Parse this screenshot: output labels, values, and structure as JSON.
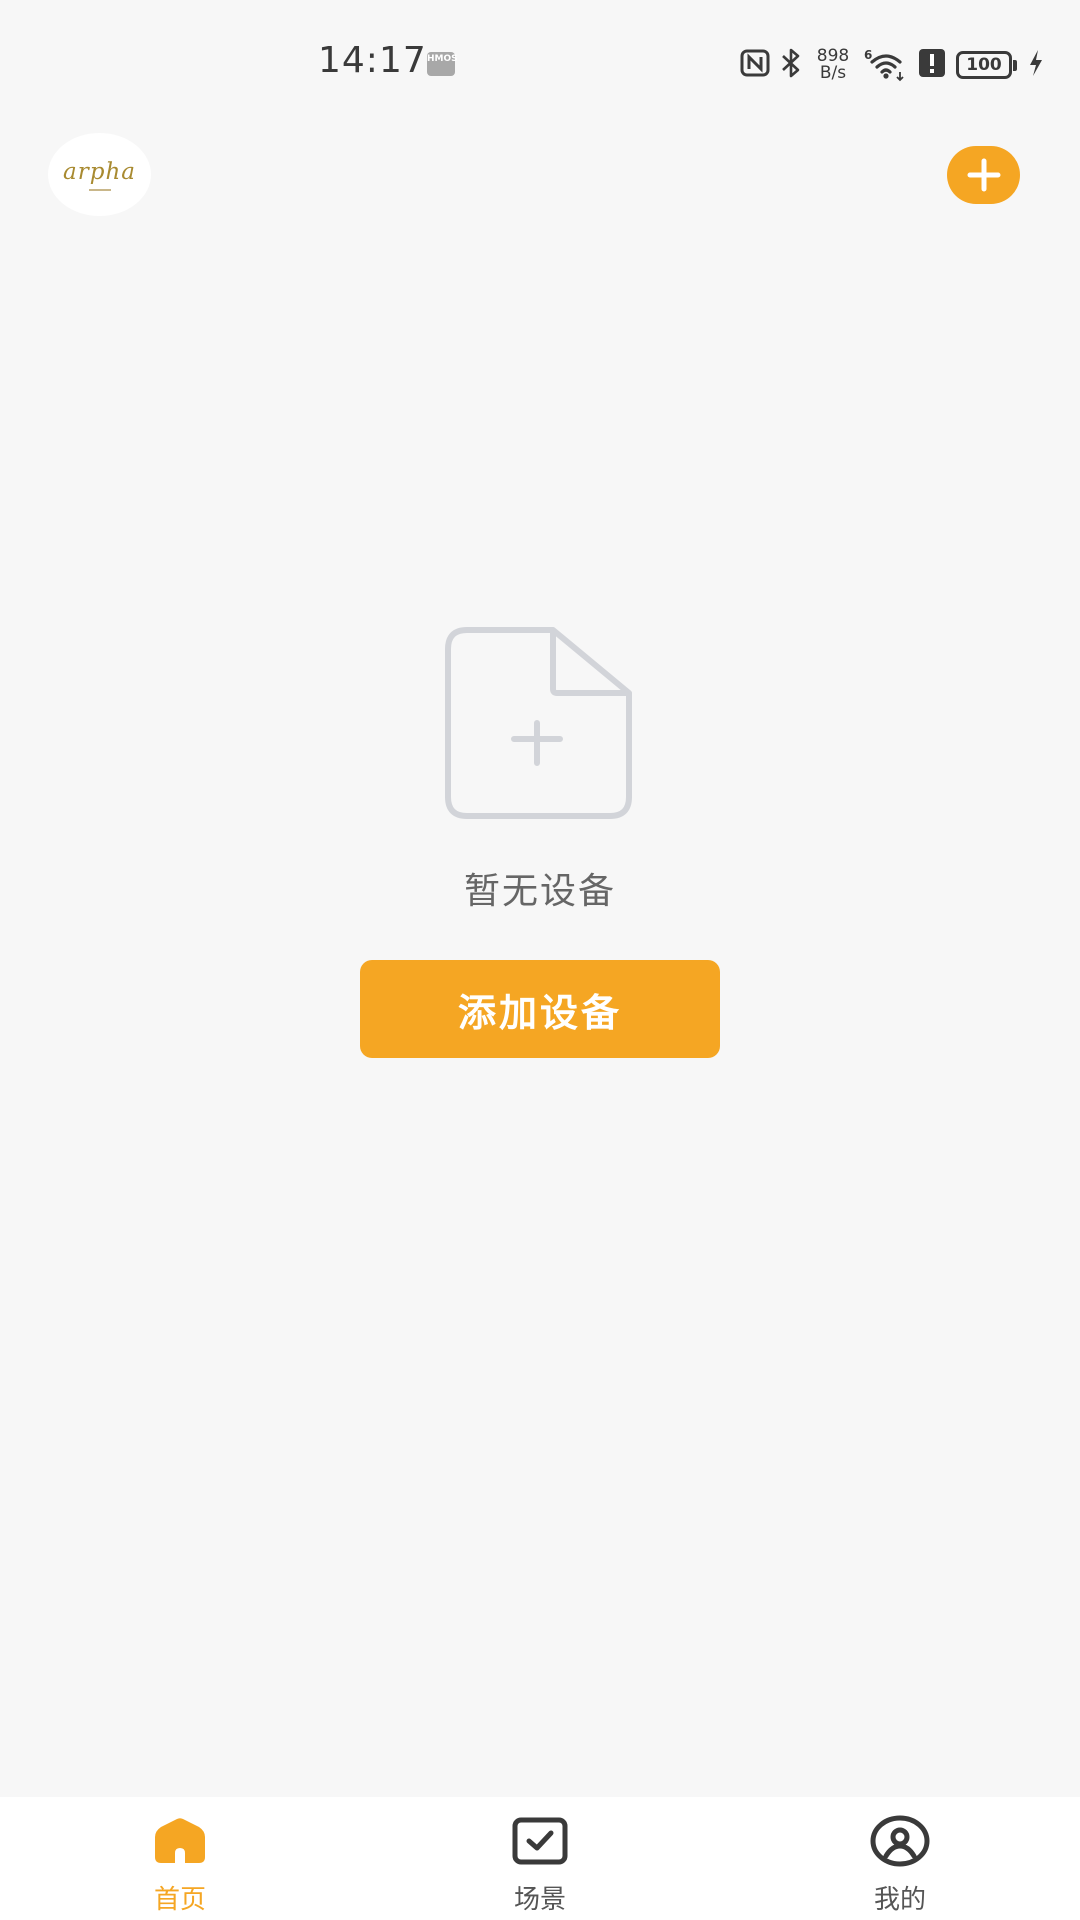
{
  "status_bar": {
    "time": "14:17",
    "os_badge": "HMOS",
    "net_speed_value": "898",
    "net_speed_unit": "B/s",
    "signal_label": "6",
    "battery": "100"
  },
  "header": {
    "logo_text": "arpha",
    "add_icon": "plus-icon"
  },
  "empty_state": {
    "icon": "add-file-icon",
    "message": "暂无设备",
    "button_label": "添加设备"
  },
  "tabs": [
    {
      "label": "首页",
      "icon": "home-icon",
      "active": true
    },
    {
      "label": "场景",
      "icon": "scene-check-icon",
      "active": false
    },
    {
      "label": "我的",
      "icon": "profile-icon",
      "active": false
    }
  ],
  "colors": {
    "accent": "#f5a623",
    "background": "#f7f7f7",
    "tab_bar": "#ffffff",
    "empty_icon": "#d2d4d9"
  }
}
